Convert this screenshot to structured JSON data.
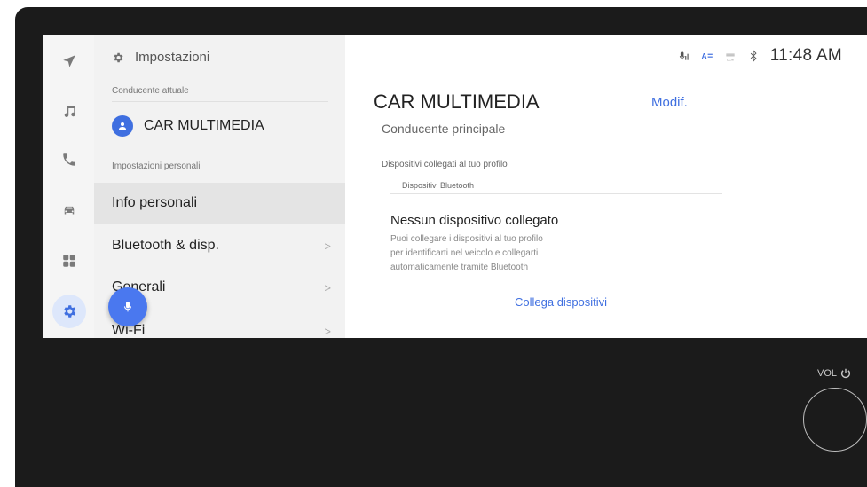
{
  "status_bar": {
    "time": "11:48 AM",
    "icons": [
      "mic-signal-icon",
      "az-icon",
      "dcm-icon",
      "bluetooth-icon"
    ],
    "dcm_label": "DCM"
  },
  "rail": {
    "items": [
      "navigation-icon",
      "music-icon",
      "phone-icon",
      "car-icon",
      "apps-icon",
      "settings-icon"
    ],
    "active": "settings-icon"
  },
  "menu": {
    "title": "Impostazioni",
    "current_driver_label": "Conducente attuale",
    "driver_name": "CAR MULTIMEDIA",
    "personal_settings_label": "Impostazioni personali",
    "items": [
      {
        "label": "Info personali",
        "selected": true
      },
      {
        "label": "Bluetooth & disp.",
        "chevron": ">"
      },
      {
        "label": "Generali",
        "chevron": ">"
      },
      {
        "label": "Wi-Fi",
        "chevron": ">"
      }
    ]
  },
  "content": {
    "title": "CAR MULTIMEDIA",
    "edit_label": "Modif.",
    "subtitle": "Conducente principale",
    "devices_label": "Dispositivi collegati al tuo profilo",
    "bluetooth_label": "Dispositivi Bluetooth",
    "no_device_title": "Nessun dispositivo collegato",
    "no_device_line1": "Puoi collegare i dispositivi al tuo profilo",
    "no_device_line2": "per identificarti nel veicolo e collegarti",
    "no_device_line3": "automaticamente tramite Bluetooth",
    "connect_label": "Collega dispositivi"
  },
  "hardware": {
    "vol_label": "VOL"
  },
  "colors": {
    "accent": "#3f6fe0",
    "bezel": "#1b1b1b"
  }
}
